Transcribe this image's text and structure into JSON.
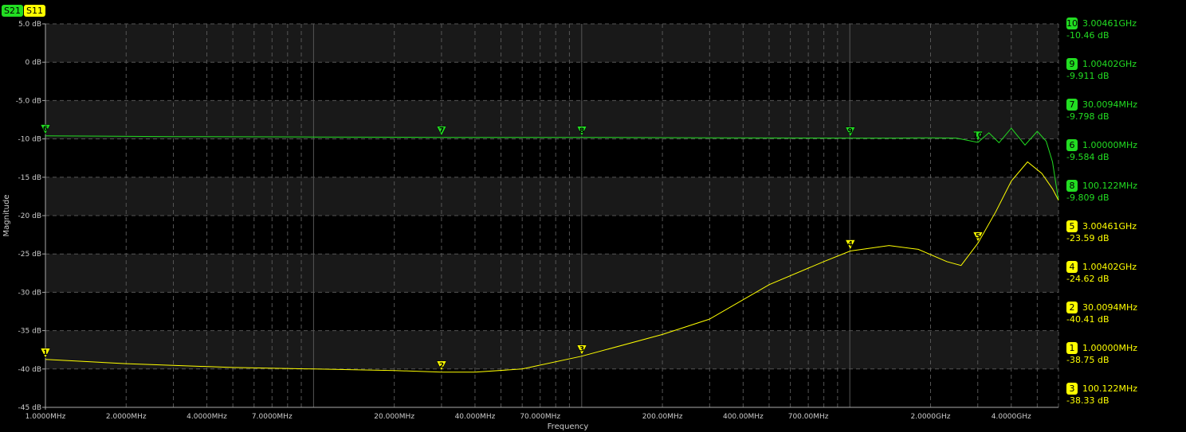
{
  "tabs": [
    {
      "label": "S21",
      "color": "#22dd22"
    },
    {
      "label": "S11",
      "color": "#ffff00"
    }
  ],
  "colors": {
    "s21": "#22dd22",
    "s11": "#ffff00",
    "band": "#191919",
    "grid": "#555555",
    "axis_text": "#cccccc"
  },
  "chart_data": {
    "type": "line",
    "xlabel": "Frequency",
    "ylabel": "Magnitude",
    "x_scale": "log",
    "xlim_hz": [
      1000000,
      6000000000
    ],
    "ylim": [
      -45,
      5
    ],
    "y_ticks": [
      "5.0 dB",
      "0 dB",
      "-5.0 dB",
      "-10 dB",
      "-15 dB",
      "-20 dB",
      "-25 dB",
      "-30 dB",
      "-35 dB",
      "-40 dB",
      "-45 dB"
    ],
    "x_tick_labels": [
      {
        "f": 1000000,
        "label": "1.0000MHz"
      },
      {
        "f": 2000000,
        "label": "2.0000MHz"
      },
      {
        "f": 4000000,
        "label": "4.0000MHz"
      },
      {
        "f": 7000000,
        "label": "7.0000MHz"
      },
      {
        "f": 20000000,
        "label": "20.000MHz"
      },
      {
        "f": 40000000,
        "label": "40.000MHz"
      },
      {
        "f": 70000000,
        "label": "70.000MHz"
      },
      {
        "f": 200000000,
        "label": "200.00MHz"
      },
      {
        "f": 400000000,
        "label": "400.00MHz"
      },
      {
        "f": 700000000,
        "label": "700.00MHz"
      },
      {
        "f": 2000000000,
        "label": "2.0000GHz"
      },
      {
        "f": 4000000000,
        "label": "4.0000GHz"
      }
    ],
    "series": [
      {
        "name": "S21",
        "color": "#22dd22",
        "points": [
          [
            1000000,
            -9.6
          ],
          [
            3000000,
            -9.7
          ],
          [
            10000000,
            -9.75
          ],
          [
            30000000,
            -9.8
          ],
          [
            100000000,
            -9.8
          ],
          [
            300000000,
            -9.85
          ],
          [
            1000000000,
            -9.9
          ],
          [
            1500000000,
            -9.9
          ],
          [
            2000000000,
            -9.85
          ],
          [
            2500000000,
            -9.9
          ],
          [
            3004610000,
            -10.46
          ],
          [
            3300000000,
            -9.2
          ],
          [
            3600000000,
            -10.5
          ],
          [
            4000000000,
            -8.6
          ],
          [
            4500000000,
            -10.8
          ],
          [
            5000000000,
            -9.0
          ],
          [
            5400000000,
            -10.3
          ],
          [
            5700000000,
            -13
          ],
          [
            6000000000,
            -18
          ]
        ]
      },
      {
        "name": "S11",
        "color": "#ffff00",
        "points": [
          [
            1000000,
            -38.75
          ],
          [
            2000000,
            -39.3
          ],
          [
            5000000,
            -39.8
          ],
          [
            10000000,
            -40
          ],
          [
            20000000,
            -40.2
          ],
          [
            30009400,
            -40.41
          ],
          [
            40000000,
            -40.4
          ],
          [
            60000000,
            -40
          ],
          [
            100122000,
            -38.33
          ],
          [
            200000000,
            -35.5
          ],
          [
            300000000,
            -33.5
          ],
          [
            500000000,
            -29
          ],
          [
            800000000,
            -26
          ],
          [
            1004020000,
            -24.62
          ],
          [
            1400000000,
            -23.9
          ],
          [
            1800000000,
            -24.4
          ],
          [
            2300000000,
            -26
          ],
          [
            2600000000,
            -26.5
          ],
          [
            3004610000,
            -23.59
          ],
          [
            3500000000,
            -19.5
          ],
          [
            4000000000,
            -15.5
          ],
          [
            4600000000,
            -13
          ],
          [
            5200000000,
            -14.5
          ],
          [
            5700000000,
            -16.5
          ],
          [
            6000000000,
            -18
          ]
        ]
      }
    ],
    "markers": [
      {
        "id": "1",
        "series": "S11",
        "f": 1000000,
        "freq_label": "1.00000MHz",
        "value_label": "-38.75 dB",
        "db": -38.75
      },
      {
        "id": "2",
        "series": "S11",
        "f": 30009400,
        "freq_label": "30.0094MHz",
        "value_label": "-40.41 dB",
        "db": -40.41
      },
      {
        "id": "3",
        "series": "S11",
        "f": 100122000,
        "freq_label": "100.122MHz",
        "value_label": "-38.33 dB",
        "db": -38.33
      },
      {
        "id": "4",
        "series": "S11",
        "f": 1004020000,
        "freq_label": "1.00402GHz",
        "value_label": "-24.62 dB",
        "db": -24.62
      },
      {
        "id": "5",
        "series": "S11",
        "f": 3004610000,
        "freq_label": "3.00461GHz",
        "value_label": "-23.59 dB",
        "db": -23.59
      },
      {
        "id": "6",
        "series": "S21",
        "f": 1000000,
        "freq_label": "1.00000MHz",
        "value_label": "-9.584 dB",
        "db": -9.584
      },
      {
        "id": "7",
        "series": "S21",
        "f": 30009400,
        "freq_label": "30.0094MHz",
        "value_label": "-9.798 dB",
        "db": -9.798
      },
      {
        "id": "8",
        "series": "S21",
        "f": 100122000,
        "freq_label": "100.122MHz",
        "value_label": "-9.809 dB",
        "db": -9.809
      },
      {
        "id": "9",
        "series": "S21",
        "f": 1004020000,
        "freq_label": "1.00402GHz",
        "value_label": "-9.911 dB",
        "db": -9.911
      },
      {
        "id": "10",
        "series": "S21",
        "f": 3004610000,
        "freq_label": "3.00461GHz",
        "value_label": "-10.46 dB",
        "db": -10.46
      }
    ],
    "readout_order": [
      "10",
      "9",
      "7",
      "6",
      "8",
      "5",
      "4",
      "2",
      "1",
      "3"
    ]
  }
}
